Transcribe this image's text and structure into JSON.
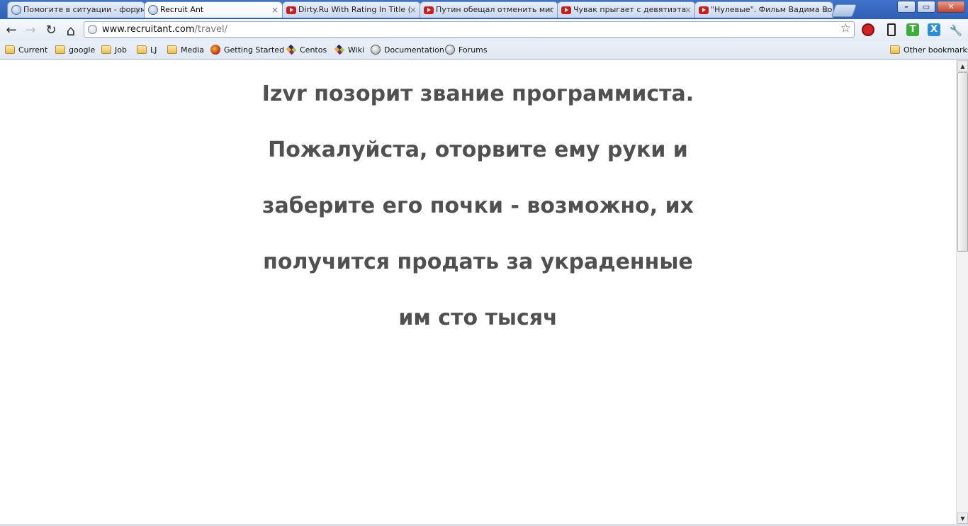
{
  "browser": {
    "tabs": [
      {
        "title": "Помогите в ситуации - форум",
        "favicon": "globe-icon",
        "active": false
      },
      {
        "title": "Recruit Ant",
        "favicon": "globe-icon",
        "active": true
      },
      {
        "title": "Dirty.Ru With Rating In Title (",
        "favicon": "youtube-icon",
        "active": false
      },
      {
        "title": "Путин обещал отменить миг",
        "favicon": "youtube-icon",
        "active": false
      },
      {
        "title": "Чувак прыгает с девятиэта",
        "favicon": "youtube-icon",
        "active": false
      },
      {
        "title": "\"Нулевые\". Фильм Вадима Во",
        "favicon": "youtube-icon",
        "active": false
      }
    ],
    "tab_close_glyph": "×",
    "window_controls": {
      "minimize": "–",
      "maximize": "▭",
      "close": "✕"
    },
    "toolbar": {
      "back": "←",
      "forward": "→",
      "reload": "↻",
      "home": "⌂",
      "url_host": "www.recruitant.com",
      "url_path": "/travel/",
      "star": "☆",
      "wrench": "🔧"
    },
    "extensions": [
      {
        "name": "adblock-icon",
        "color": "#d42020"
      },
      {
        "name": "phone-icon",
        "color": "#222222"
      },
      {
        "name": "translate-icon",
        "label": "T",
        "color": "#3cae3a"
      },
      {
        "name": "xmarks-icon",
        "label": "X",
        "color": "#2a8fd8"
      }
    ],
    "bookmarks": [
      {
        "label": "Current",
        "icon": "folder-icon"
      },
      {
        "label": "google",
        "icon": "folder-icon"
      },
      {
        "label": "Job",
        "icon": "folder-icon"
      },
      {
        "label": "LJ",
        "icon": "folder-icon"
      },
      {
        "label": "Media",
        "icon": "folder-icon"
      },
      {
        "label": "Getting Started",
        "icon": "firefox-icon"
      },
      {
        "label": "Centos",
        "icon": "centos-icon"
      },
      {
        "label": "Wiki",
        "icon": "centos-icon"
      },
      {
        "label": "Documentation",
        "icon": "globe-icon"
      },
      {
        "label": "Forums",
        "icon": "globe-icon"
      }
    ],
    "other_bookmarks": "Other bookmarks"
  },
  "page": {
    "lines": [
      "Izvr позорит звание программиста.",
      "Пожалуйста, оторвите ему руки и",
      "заберите его почки - возможно, их",
      "получится продать за украденные",
      "им сто тысяч"
    ],
    "text_color": "#505050"
  }
}
